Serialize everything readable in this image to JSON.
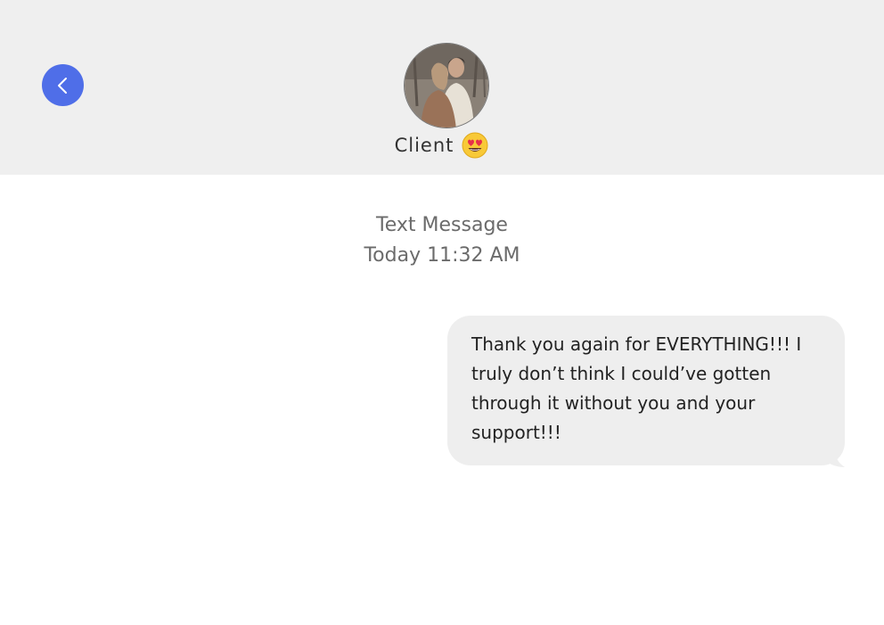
{
  "header": {
    "back_icon": "chevron-left-icon",
    "accent_color": "#4f6ee8",
    "contact_name": "Client",
    "contact_emoji": "heart-eyes-emoji"
  },
  "thread": {
    "service_label": "Text Message",
    "timestamp": "Today 11:32 AM"
  },
  "messages": [
    {
      "direction": "outgoing",
      "text": "Thank you again for EVERYTHING!!! I truly don’t think I could’ve gotten through it without you and your support!!!"
    }
  ]
}
